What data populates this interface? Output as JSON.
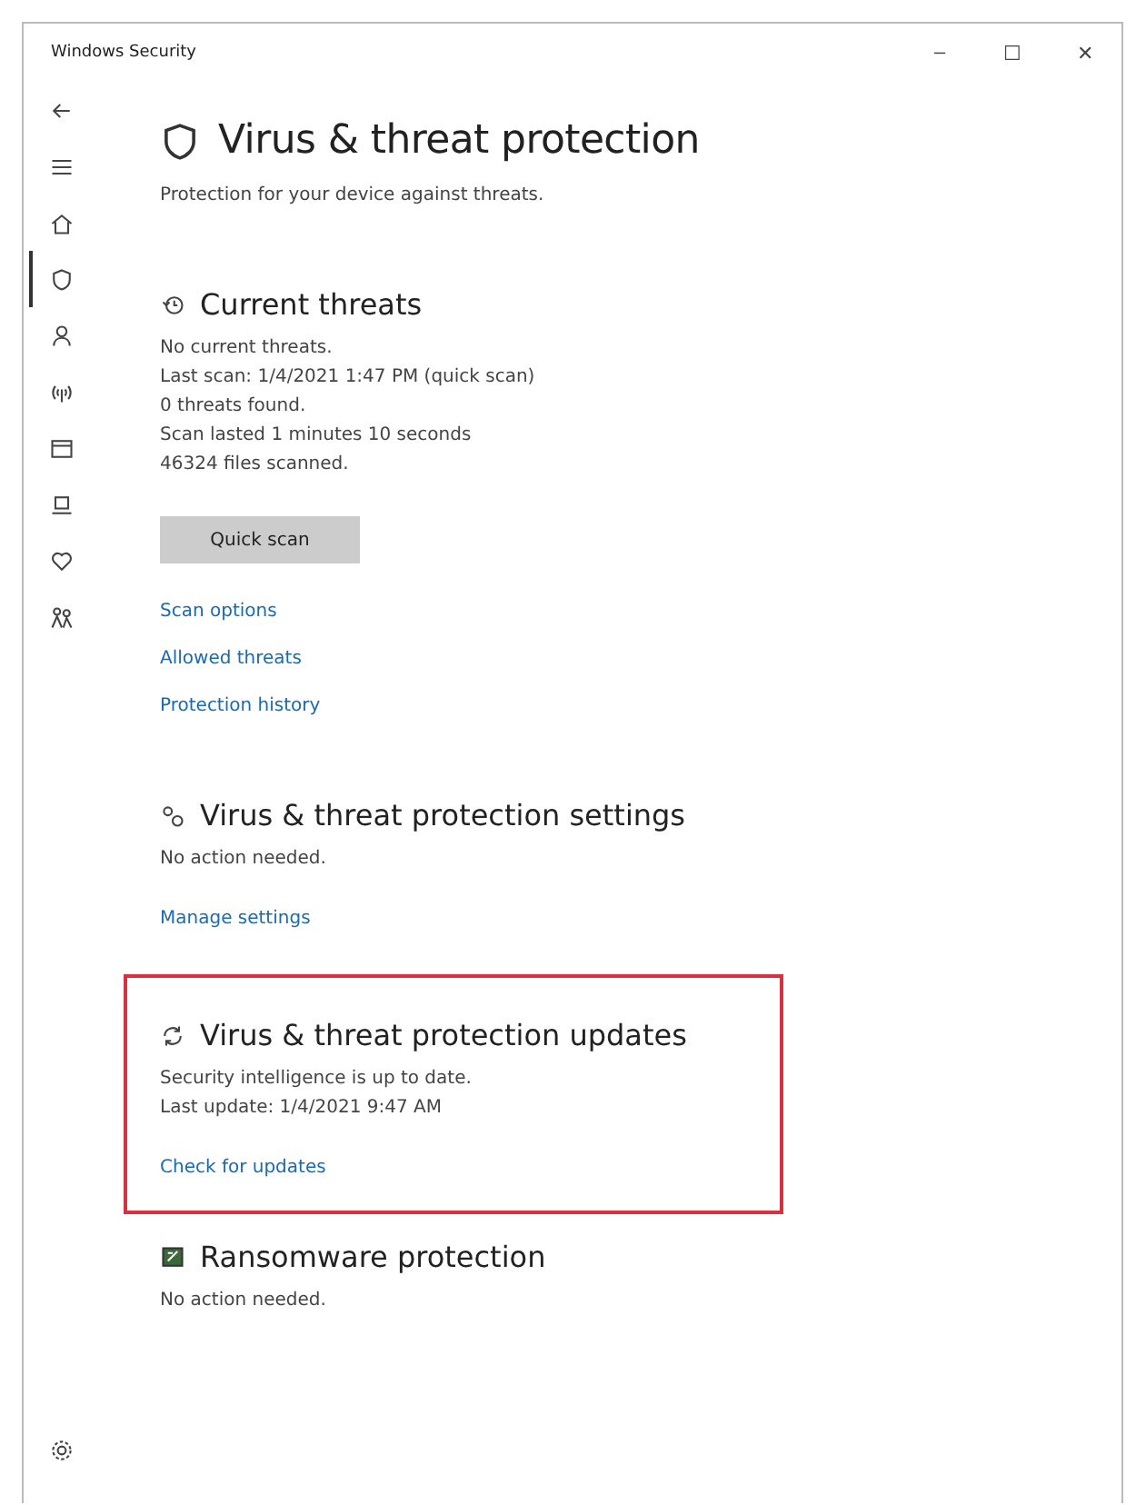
{
  "window": {
    "title": "Windows Security",
    "controls": [
      "–",
      "☐",
      "✕"
    ]
  },
  "sidebar": {
    "items": [
      {
        "kind": "back",
        "selected": false
      },
      {
        "kind": "menu",
        "selected": false
      },
      {
        "kind": "home",
        "selected": false
      },
      {
        "kind": "shield",
        "selected": true
      },
      {
        "kind": "person",
        "selected": false
      },
      {
        "kind": "wifi",
        "selected": false
      },
      {
        "kind": "app",
        "selected": false
      },
      {
        "kind": "laptop",
        "selected": false
      },
      {
        "kind": "heart",
        "selected": false
      },
      {
        "kind": "family",
        "selected": false
      }
    ],
    "footer": {
      "kind": "gear"
    }
  },
  "page": {
    "title": "Virus & threat protection",
    "subtitle": "Protection for your device against threats."
  },
  "sections": [
    {
      "kind": "history",
      "title": "Current threats",
      "highlighted": false,
      "lines": [
        "No current threats.",
        "Last scan: 1/4/2021 1:47 PM (quick scan)",
        "0 threats found.",
        "Scan lasted 1 minutes 10 seconds",
        "46324 files scanned."
      ],
      "button": "Quick scan",
      "links": [
        "Scan options",
        "Allowed threats",
        "Protection history"
      ]
    },
    {
      "kind": "settings",
      "title": "Virus & threat protection settings",
      "highlighted": false,
      "lines": [
        "No action needed."
      ],
      "links": [
        "Manage settings"
      ]
    },
    {
      "kind": "refresh",
      "title": "Virus & threat protection updates",
      "highlighted": true,
      "lines": [
        "Security intelligence is up to date.",
        "Last update: 1/4/2021 9:47 AM"
      ],
      "links": [
        "Check for updates"
      ]
    },
    {
      "kind": "ransomware",
      "title": "Ransomware protection",
      "highlighted": false,
      "lines": [
        "No action needed."
      ]
    }
  ]
}
